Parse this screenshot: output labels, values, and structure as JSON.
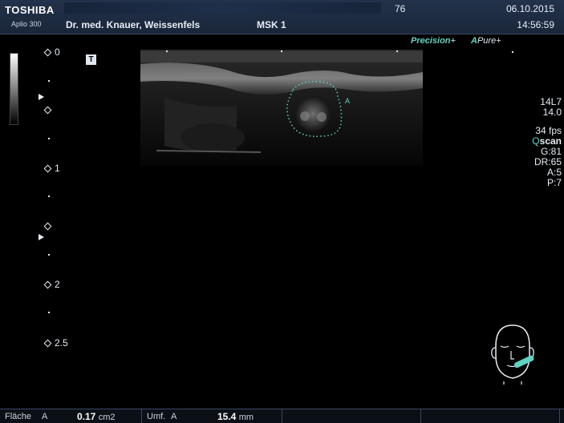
{
  "header": {
    "brand": "TOSHIBA",
    "model": "Aplio 300",
    "clinic": "Dr. med. Knauer, Weissenfels",
    "preset": "MSK 1",
    "indicator": "76",
    "date": "06.10.2015",
    "time": "14:56:59"
  },
  "logos": {
    "precision_a": "Precision",
    "precision_b": "+",
    "pure_a": "A",
    "pure_b": "Pure",
    "pure_c": "+"
  },
  "depth_scale": {
    "labels": [
      "0",
      "1",
      "2",
      "2.5"
    ]
  },
  "marker_label": "T",
  "roi_label": "A",
  "params": {
    "probe": "14L7",
    "depth": "14.0",
    "fps": "34 fps",
    "qscan_q": "Q",
    "qscan_rest": "scan",
    "gain": "G:81",
    "dr": "DR:65",
    "a": "A:5",
    "p": "P:7"
  },
  "measurements": {
    "area_label": "Fläche",
    "area_id": "A",
    "area_value": "0.17",
    "area_unit": "cm2",
    "perim_label": "Umf.",
    "perim_id": "A",
    "perim_value": "15.4",
    "perim_unit": "mm"
  },
  "colors": {
    "accent": "#5fd3c3",
    "header_bg": "#1f2d44"
  }
}
